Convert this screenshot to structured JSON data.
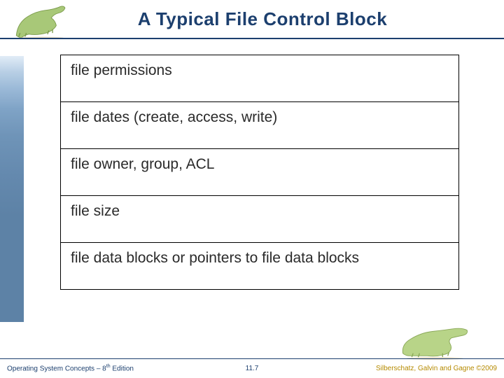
{
  "title": "A Typical File Control Block",
  "fcb_rows": [
    "file permissions",
    "file dates (create, access, write)",
    "file owner, group, ACL",
    "file size",
    "file data blocks or pointers to file data blocks"
  ],
  "footer": {
    "left_prefix": "Operating System Concepts – 8",
    "left_suffix": " Edition",
    "left_sup": "th",
    "center": "11.7",
    "right": "Silberschatz, Galvin and Gagne ©2009"
  }
}
